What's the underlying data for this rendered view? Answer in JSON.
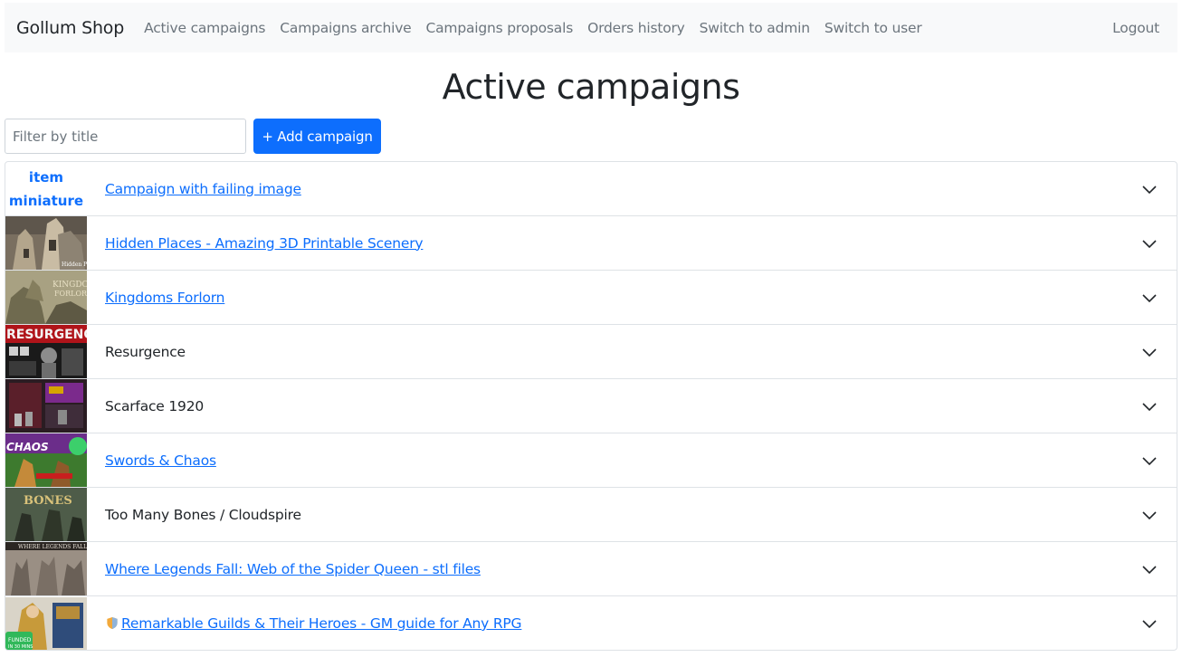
{
  "navbar": {
    "brand": "Gollum Shop",
    "links": [
      "Active campaigns",
      "Campaigns archive",
      "Campaigns proposals",
      "Orders history",
      "Switch to admin",
      "Switch to user"
    ],
    "logout": "Logout"
  },
  "page": {
    "title": "Active campaigns"
  },
  "filter": {
    "placeholder": "Filter by title",
    "value": ""
  },
  "add_button": "+ Add campaign",
  "campaigns": [
    {
      "title": "Campaign with failing image",
      "linked": true,
      "image_alt": "item miniature",
      "image_alt_line1": "item",
      "image_alt_line2": "miniature"
    },
    {
      "title": "Hidden Places - Amazing 3D Printable Scenery",
      "linked": true
    },
    {
      "title": "Kingdoms Forlorn",
      "linked": true
    },
    {
      "title": "Resurgence",
      "linked": false
    },
    {
      "title": "Scarface 1920",
      "linked": false
    },
    {
      "title": "Swords & Chaos",
      "linked": true
    },
    {
      "title": "Too Many Bones / Cloudspire",
      "linked": false
    },
    {
      "title": "Where Legends Fall: Web of the Spider Queen - stl files",
      "linked": true
    },
    {
      "title": "Remarkable Guilds & Their Heroes - GM guide for Any RPG",
      "linked": true,
      "prefix_icon": "shield-icon"
    }
  ],
  "colors": {
    "primary": "#0d6efd",
    "navbar_bg": "#f8f9fa",
    "muted": "#6c757d",
    "text": "#212529",
    "border": "#dee2e6"
  }
}
